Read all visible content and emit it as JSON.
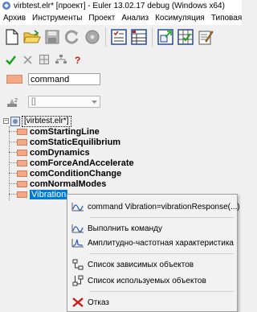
{
  "window": {
    "title": "virbtest.elr* [проект] - Euler 13.02.17 debug (Windows x64)"
  },
  "menubar": {
    "items": [
      "Архив",
      "Инструменты",
      "Проект",
      "Анализ",
      "Косимуляция",
      "Типовая модель"
    ]
  },
  "toolbar": {
    "icons": [
      "new-document-icon",
      "open-folder-icon",
      "save-icon",
      "refresh-icon",
      "disk-icon",
      "checklist-icon",
      "table-icon",
      "export-icon",
      "grid-check-icon",
      "pen-notes-icon"
    ]
  },
  "panel": {
    "actions": [
      "check-icon",
      "cancel-icon",
      "grid-icon",
      "hierarchy-icon",
      "help-icon"
    ],
    "name_value": "command",
    "type_value": "[]"
  },
  "tree": {
    "root": "[virbtest.elr*]",
    "items": [
      {
        "label": "comStartingLine"
      },
      {
        "label": "comStaticEquilibrium"
      },
      {
        "label": "comDynamics"
      },
      {
        "label": "comForceAndAccelerate"
      },
      {
        "label": "comConditionChange"
      },
      {
        "label": "comNormalModes"
      },
      {
        "label": "Vibration"
      }
    ]
  },
  "context_menu": {
    "items": [
      {
        "label": "command Vibration=vibrationResponse(...)",
        "icon": "wave-icon"
      },
      {
        "label": "Выполнить команду",
        "icon": "wave-icon"
      },
      {
        "label": "Амплитудно-частотная характеристика",
        "icon": "frequency-response-icon"
      },
      {
        "label": "Список зависимых объектов",
        "icon": "tree-icon"
      },
      {
        "label": "Список используемых объектов",
        "icon": "tree-icon"
      },
      {
        "label": "Отказ",
        "icon": "cancel-x-icon"
      }
    ]
  },
  "colors": {
    "selection": "#0078d7",
    "command_swatch": "#f4a986",
    "check": "#1aa31a",
    "cancel": "#e02020"
  }
}
